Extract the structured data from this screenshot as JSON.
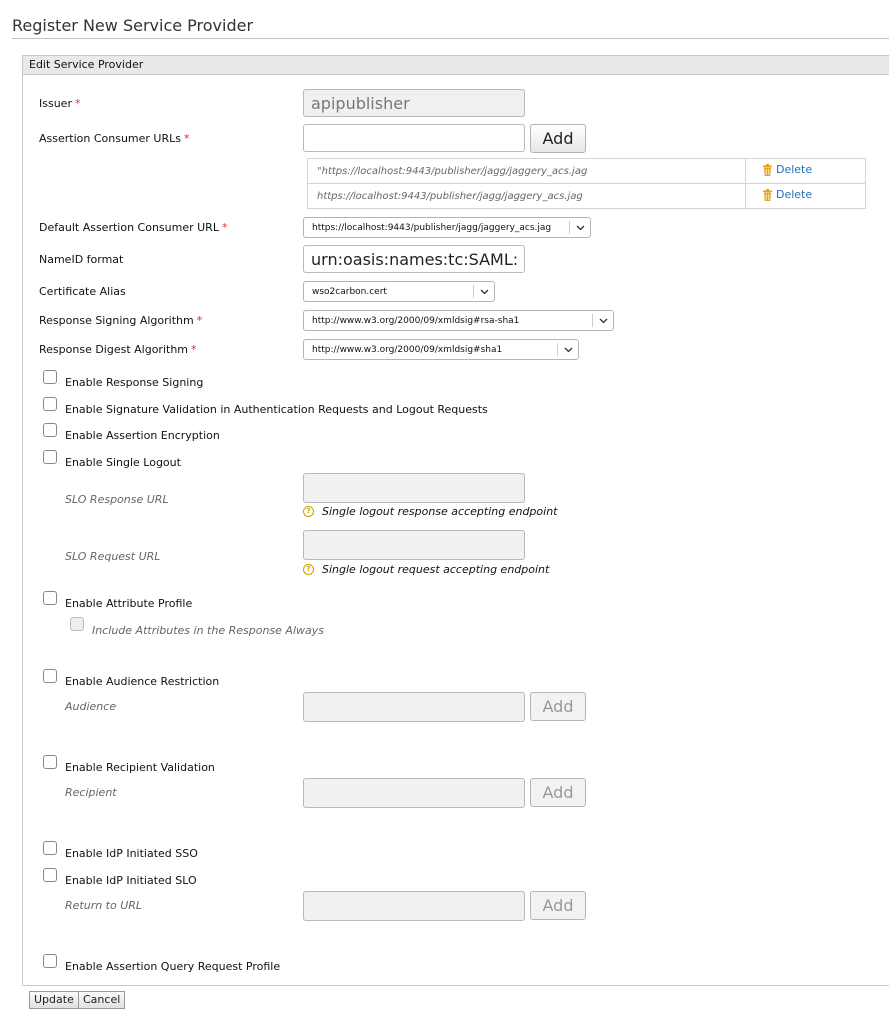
{
  "page_title": "Register New Service Provider",
  "panel_title": "Edit Service Provider",
  "issuer": {
    "label": "Issuer",
    "value": "apipublisher"
  },
  "assertion_consumer_urls": {
    "label": "Assertion Consumer URLs",
    "input_value": "",
    "add_label": "Add",
    "rows": [
      {
        "url": "\"https://localhost:9443/publisher/jagg/jaggery_acs.jag",
        "delete_label": "Delete"
      },
      {
        "url": "https://localhost:9443/publisher/jagg/jaggery_acs.jag",
        "delete_label": "Delete"
      }
    ]
  },
  "default_acs_url": {
    "label": "Default Assertion Consumer URL",
    "value": "https://localhost:9443/publisher/jagg/jaggery_acs.jag"
  },
  "nameid_format": {
    "label": "NameID format",
    "value": "urn:oasis:names:tc:SAML:1."
  },
  "certificate_alias": {
    "label": "Certificate Alias",
    "value": "wso2carbon.cert"
  },
  "response_signing_algorithm": {
    "label": "Response Signing Algorithm",
    "value": "http://www.w3.org/2000/09/xmldsig#rsa-sha1"
  },
  "response_digest_algorithm": {
    "label": "Response Digest Algorithm",
    "value": "http://www.w3.org/2000/09/xmldsig#sha1"
  },
  "checkboxes": {
    "response_signing": "Enable Response Signing",
    "signature_validation": "Enable Signature Validation in Authentication Requests and Logout Requests",
    "assertion_encryption": "Enable Assertion Encryption",
    "single_logout": "Enable Single Logout",
    "attribute_profile": "Enable Attribute Profile",
    "include_attributes": "Include Attributes in the Response Always",
    "audience_restriction": "Enable Audience Restriction",
    "recipient_validation": "Enable Recipient Validation",
    "idp_initiated_sso": "Enable IdP Initiated SSO",
    "idp_initiated_slo": "Enable IdP Initiated SLO",
    "assertion_query": "Enable Assertion Query Request Profile"
  },
  "slo": {
    "response_url_label": "SLO Response URL",
    "response_url_hint": "Single logout response accepting endpoint",
    "request_url_label": "SLO Request URL",
    "request_url_hint": "Single logout request accepting endpoint"
  },
  "audience": {
    "label": "Audience",
    "add_label": "Add"
  },
  "recipient": {
    "label": "Recipient",
    "add_label": "Add"
  },
  "return_to_url": {
    "label": "Return to URL",
    "add_label": "Add"
  },
  "actions": {
    "update": "Update",
    "cancel": "Cancel"
  },
  "colors": {
    "required": "#d32f2f",
    "link": "#2a6fb5",
    "hint_icon": "#c9a000",
    "delete_icon": "#e8a318"
  }
}
